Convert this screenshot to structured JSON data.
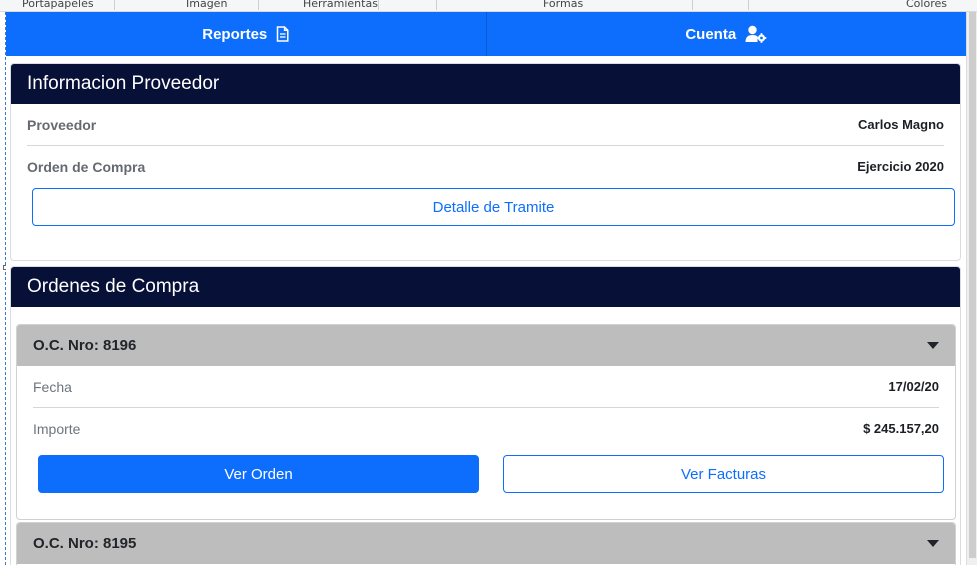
{
  "ribbon": {
    "groups": [
      "Portapapeles",
      "Imagen",
      "Herramientas",
      "Formas",
      "Colores"
    ]
  },
  "nav": {
    "reportes_label": "Reportes",
    "reportes_icon": "document-icon",
    "cuenta_label": "Cuenta",
    "cuenta_icon": "user-gear-icon",
    "color": "#0d6efd"
  },
  "proveedor_card": {
    "title": "Informacion Proveedor",
    "rows": [
      {
        "label": "Proveedor",
        "value": "Carlos Magno"
      },
      {
        "label": "Orden de Compra",
        "value": "Ejercicio 2020"
      }
    ],
    "button_label": "Detalle de Tramite"
  },
  "ordenes_card": {
    "title": "Ordenes de Compra",
    "orders": [
      {
        "header": "O.C. Nro: 8196",
        "expanded": true,
        "rows": [
          {
            "label": "Fecha",
            "value": "17/02/20"
          },
          {
            "label": "Importe",
            "value": "$ 245.157,20"
          }
        ],
        "ver_orden_label": "Ver Orden",
        "ver_facturas_label": "Ver Facturas"
      },
      {
        "header": "O.C. Nro: 8195",
        "expanded": false
      }
    ]
  },
  "colors": {
    "header_bg": "#071037",
    "accordion_bg": "#bdbdbd",
    "primary": "#0d6efd"
  }
}
